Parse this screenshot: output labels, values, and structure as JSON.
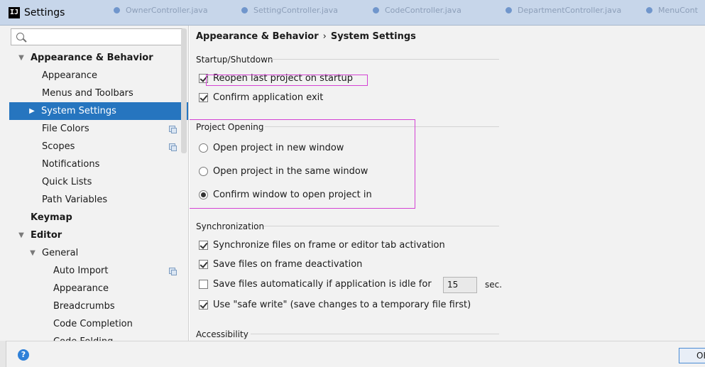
{
  "window": {
    "title": "Settings",
    "app_icon": "intellij-icon"
  },
  "background_tabs": [
    "OwnerController.java",
    "SettingController.java",
    "CodeController.java",
    "DepartmentController.java",
    "MenuCont"
  ],
  "search": {
    "placeholder": "",
    "value": ""
  },
  "sidebar": {
    "items": [
      {
        "label": "Appearance & Behavior",
        "level": 0,
        "expanded": true,
        "bold": true
      },
      {
        "label": "Appearance",
        "level": 1
      },
      {
        "label": "Menus and Toolbars",
        "level": 1
      },
      {
        "label": "System Settings",
        "level": 1,
        "selected": true,
        "collapsed": true
      },
      {
        "label": "File Colors",
        "level": 1,
        "icon": "copy-icon"
      },
      {
        "label": "Scopes",
        "level": 1,
        "icon": "copy-icon"
      },
      {
        "label": "Notifications",
        "level": 1
      },
      {
        "label": "Quick Lists",
        "level": 1
      },
      {
        "label": "Path Variables",
        "level": 1
      },
      {
        "label": "Keymap",
        "level": 0,
        "bold": true
      },
      {
        "label": "Editor",
        "level": 0,
        "expanded": true,
        "bold": true
      },
      {
        "label": "General",
        "level": 1,
        "expanded": true
      },
      {
        "label": "Auto Import",
        "level": 2,
        "icon": "copy-icon"
      },
      {
        "label": "Appearance",
        "level": 2
      },
      {
        "label": "Breadcrumbs",
        "level": 2
      },
      {
        "label": "Code Completion",
        "level": 2
      },
      {
        "label": "Code Folding",
        "level": 2
      }
    ]
  },
  "main": {
    "breadcrumb": {
      "parent": "Appearance & Behavior",
      "separator": "›",
      "current": "System Settings"
    },
    "startup": {
      "title": "Startup/Shutdown",
      "reopen_label": "Reopen last project on startup",
      "reopen_checked": true,
      "confirm_exit_label": "Confirm application exit",
      "confirm_exit_checked": true
    },
    "project_opening": {
      "title": "Project Opening",
      "options": [
        {
          "label": "Open project in new window",
          "selected": false
        },
        {
          "label": "Open project in the same window",
          "selected": false
        },
        {
          "label": "Confirm window to open project in",
          "selected": true
        }
      ]
    },
    "sync": {
      "title": "Synchronization",
      "sync_files_label": "Synchronize files on frame or editor tab activation",
      "sync_files_checked": true,
      "save_deactivation_label": "Save files on frame deactivation",
      "save_deactivation_checked": true,
      "save_idle_label": "Save files automatically if application is idle for",
      "save_idle_checked": false,
      "idle_seconds": "15",
      "idle_unit": "sec.",
      "safe_write_label": "Use \"safe write\" (save changes to a temporary file first)",
      "safe_write_checked": true
    },
    "accessibility": {
      "title": "Accessibility"
    }
  },
  "footer": {
    "help_label": "?",
    "ok_label": "OK"
  },
  "colors": {
    "selection": "#2675bf",
    "highlight_annotation": "#d442d4",
    "titlebar": "#c7d6ea"
  }
}
